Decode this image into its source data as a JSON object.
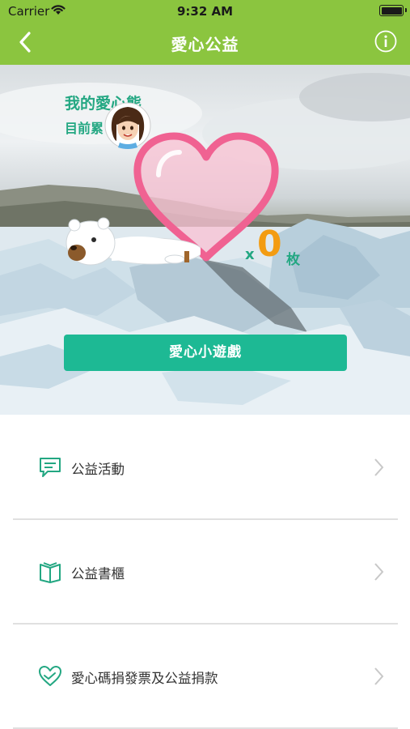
{
  "status_bar": {
    "carrier": "Carrier",
    "time": "9:32 AM"
  },
  "nav": {
    "title": "愛心公益"
  },
  "hero": {
    "title": "我的愛心熊",
    "subtitle": "目前累",
    "count_prefix": "x",
    "count": "0",
    "count_unit": "枚",
    "game_button": "愛心小遊戲"
  },
  "menu": {
    "items": [
      {
        "label": "公益活動",
        "icon": "chat-bubble-icon"
      },
      {
        "label": "公益書櫃",
        "icon": "book-icon"
      },
      {
        "label": "愛心碼捐發票及公益捐款",
        "icon": "heart-hands-icon"
      }
    ]
  },
  "colors": {
    "accent": "#8bc53f",
    "teal": "#1db994",
    "heart": "#f06292",
    "count": "#f39c12"
  }
}
